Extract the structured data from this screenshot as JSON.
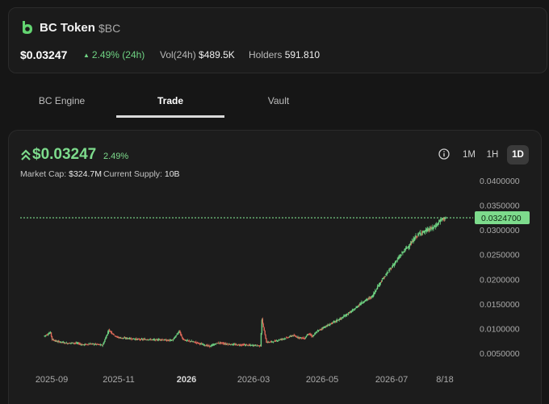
{
  "header": {
    "token_name": "BC Token",
    "token_symbol": "$BC",
    "price": "$0.03247",
    "change_24h": "2.49% (24h)",
    "vol_label": "Vol(24h)",
    "vol_value": "$489.5K",
    "holders_label": "Holders",
    "holders_value": "591.810"
  },
  "tabs": [
    {
      "label": "BC Engine",
      "active": false
    },
    {
      "label": "Trade",
      "active": true
    },
    {
      "label": "Vault",
      "active": false
    }
  ],
  "chart_panel": {
    "price": "$0.03247",
    "change": "2.49%",
    "market_cap_label": "Market Cap:",
    "market_cap_value": "$324.7M",
    "supply_label": "Current Supply:",
    "supply_value": "10B",
    "ranges": [
      {
        "label": "1M",
        "active": false
      },
      {
        "label": "1H",
        "active": false
      },
      {
        "label": "1D",
        "active": true
      }
    ],
    "price_tag": "0.0324700"
  },
  "colors": {
    "accent_green": "#7ddb8c",
    "candle_up": "#6fd383",
    "candle_down": "#e26a5a",
    "logo_green": "#63d471"
  },
  "icons": {
    "logo": "bc-token-logo",
    "price_arrow": "double-chevron-up-icon",
    "info": "info-circle-icon"
  },
  "chart_data": {
    "type": "line",
    "y_tick_labels": [
      "0.0400000",
      "0.0350000",
      "0.0300000",
      "0.0250000",
      "0.0200000",
      "0.0150000",
      "0.0100000",
      "0.0050000"
    ],
    "y_ticks": [
      0.04,
      0.035,
      0.03,
      0.025,
      0.02,
      0.015,
      0.01,
      0.005
    ],
    "ylim": [
      0.0028,
      0.0425
    ],
    "x_tick_labels": [
      "2025-09",
      "2025-11",
      "2026",
      "2026-03",
      "2026-05",
      "2026-07",
      "8/18"
    ],
    "x_tick_bold": [
      false,
      false,
      true,
      false,
      false,
      false,
      false
    ],
    "current_price": 0.03247,
    "series": [
      {
        "x": [
          0,
          4,
          5,
          8,
          12,
          15,
          18,
          22,
          25,
          30,
          34,
          38,
          42,
          47,
          50,
          55,
          58,
          62,
          68,
          72,
          76,
          80,
          84,
          88,
          90,
          92,
          96,
          100,
          104,
          108,
          111,
          112,
          115,
          118,
          122,
          126,
          130,
          134,
          138,
          141,
          142,
          145,
          150,
          154,
          158,
          162,
          166,
          170,
          172,
          175,
          178,
          182,
          186,
          190,
          194,
          198,
          202,
          206,
          210,
          214,
          218,
          222,
          226,
          230,
          234,
          236,
          238,
          240,
          242,
          244,
          246,
          248,
          250,
          252,
          254,
          256,
          258,
          260,
          261,
          262
        ],
        "values": [
          0.0085,
          0.0092,
          0.0078,
          0.0074,
          0.0072,
          0.007,
          0.0071,
          0.007,
          0.0067,
          0.0069,
          0.0068,
          0.0066,
          0.0097,
          0.0083,
          0.0081,
          0.008,
          0.0079,
          0.0078,
          0.0078,
          0.0077,
          0.0078,
          0.0076,
          0.0077,
          0.0095,
          0.008,
          0.0076,
          0.0074,
          0.0071,
          0.0067,
          0.0064,
          0.0068,
          0.007,
          0.0071,
          0.0069,
          0.0068,
          0.0067,
          0.0067,
          0.0066,
          0.0066,
          0.0065,
          0.0118,
          0.0072,
          0.0074,
          0.0078,
          0.0081,
          0.0086,
          0.0082,
          0.008,
          0.009,
          0.0084,
          0.0094,
          0.0102,
          0.0108,
          0.0115,
          0.0121,
          0.013,
          0.0138,
          0.015,
          0.0158,
          0.0165,
          0.0188,
          0.0205,
          0.0222,
          0.0238,
          0.0255,
          0.0262,
          0.0268,
          0.0275,
          0.0285,
          0.029,
          0.0295,
          0.0296,
          0.03,
          0.0302,
          0.0305,
          0.031,
          0.0318,
          0.0322,
          0.0324,
          0.03247
        ]
      }
    ]
  }
}
